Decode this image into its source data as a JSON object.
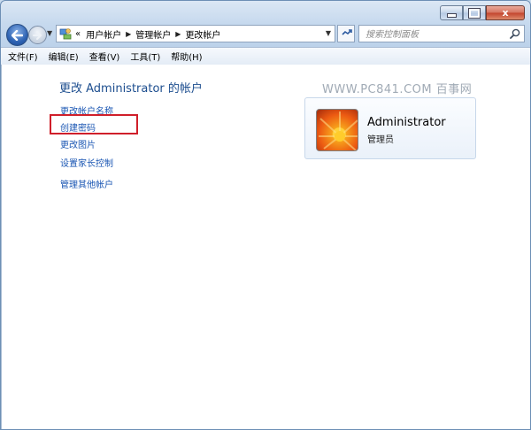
{
  "window": {
    "minimize": "",
    "maximize": "",
    "close": "x"
  },
  "nav": {
    "breadcrumb_prefix": "«",
    "breadcrumbs": [
      "用户帐户",
      "管理帐户",
      "更改帐户"
    ],
    "search_placeholder": "搜索控制面板"
  },
  "menubar": {
    "items": [
      "文件(F)",
      "编辑(E)",
      "查看(V)",
      "工具(T)",
      "帮助(H)"
    ]
  },
  "main": {
    "title": "更改 Administrator 的帐户",
    "links": [
      "更改帐户名称",
      "创建密码",
      "更改图片",
      "设置家长控制",
      "管理其他帐户"
    ],
    "watermark": "WWW.PC841.COM 百事网"
  },
  "account": {
    "name": "Administrator",
    "role": "管理员"
  },
  "colors": {
    "link": "#1a56b3",
    "title": "#1d4e8f",
    "highlight": "#d01f2a"
  }
}
